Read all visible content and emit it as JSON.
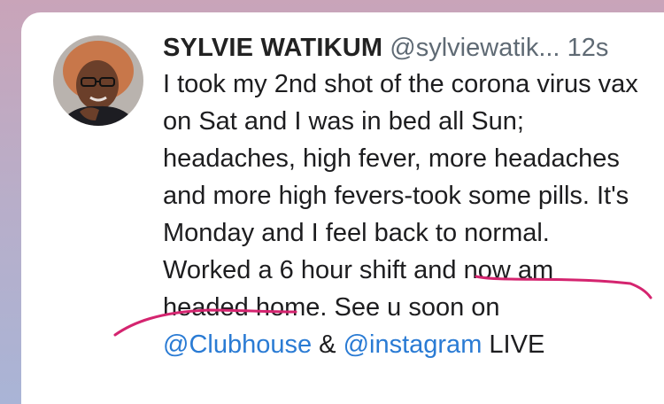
{
  "tweet": {
    "author_name": "SYLVIE WATIKUM",
    "handle": "@sylviewatik...",
    "time": "12s",
    "body_part1": "I took my 2nd shot of the corona virus vax on Sat and I was in bed all Sun; headaches, high fever, more headaches and more high fevers-took some pills. It's Monday and I feel back to normal. Worked a 6 hour shift and now am headed home. See u soon on ",
    "mention1": "@Clubhouse",
    "amp": " & ",
    "mention2": "@instagram",
    "tail": " LIVE"
  },
  "colors": {
    "mention": "#2a7bd4",
    "underline": "#d4246f"
  }
}
